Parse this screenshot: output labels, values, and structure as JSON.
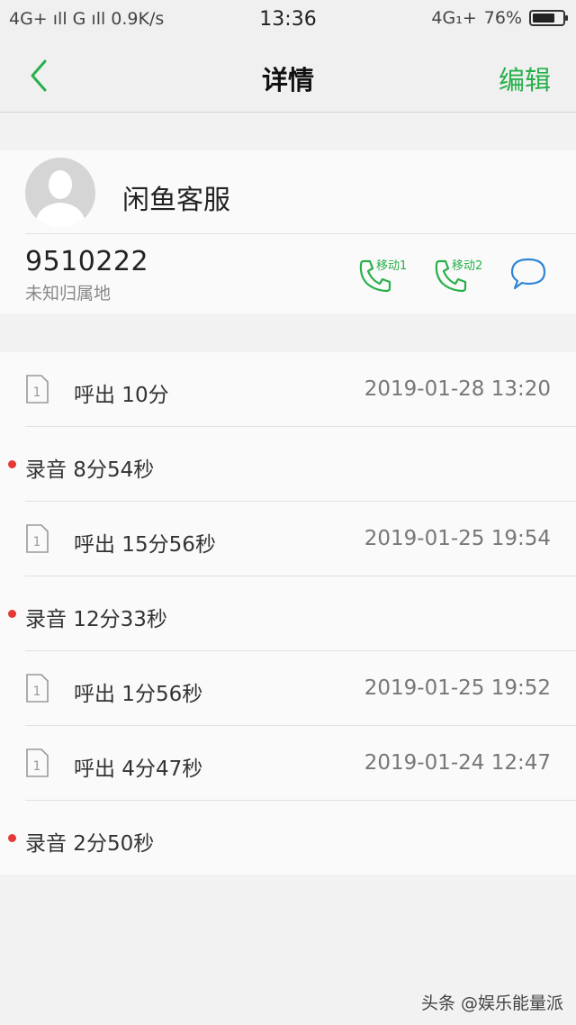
{
  "status_bar": {
    "left": "4G+ ıll G ıll 0.9K/s",
    "time": "13:36",
    "network": "4G₁+",
    "battery": "76%",
    "battery_level": 0.76
  },
  "nav": {
    "title": "详情",
    "edit_label": "编辑",
    "accent_color": "#27b04a"
  },
  "contact": {
    "name": "闲鱼客服",
    "number": "9510222",
    "location": "未知归属地",
    "call_sim1_label": "移动1",
    "call_sim2_label": "移动2"
  },
  "history": [
    {
      "type": "call",
      "label": "呼出 10分",
      "time": "2019-01-28 13:20",
      "sim": "1"
    },
    {
      "type": "recording",
      "label": "录音 8分54秒"
    },
    {
      "type": "call",
      "label": "呼出 15分56秒",
      "time": "2019-01-25 19:54",
      "sim": "1"
    },
    {
      "type": "recording",
      "label": "录音 12分33秒"
    },
    {
      "type": "call",
      "label": "呼出 1分56秒",
      "time": "2019-01-25 19:52",
      "sim": "1"
    },
    {
      "type": "call",
      "label": "呼出 4分47秒",
      "time": "2019-01-24 12:47",
      "sim": "1"
    },
    {
      "type": "recording",
      "label": "录音 2分50秒"
    }
  ],
  "watermark": "头条 @娱乐能量派"
}
